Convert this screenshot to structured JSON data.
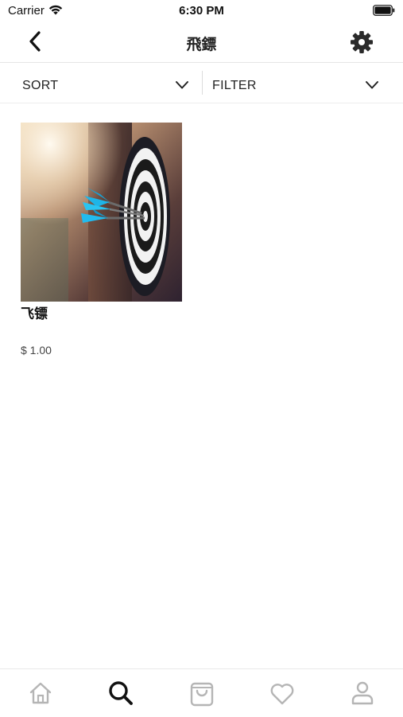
{
  "status_bar": {
    "carrier": "Carrier",
    "time": "6:30 PM"
  },
  "nav": {
    "title": "飛鏢",
    "back_icon": "chevron-left-icon",
    "settings_icon": "gear-icon"
  },
  "toolbar": {
    "sort_label": "SORT",
    "filter_label": "FILTER"
  },
  "products": [
    {
      "name": "飞镖",
      "price": "$ 1.00",
      "image": "dartboard-photo"
    }
  ],
  "tab_bar": {
    "tabs": [
      {
        "icon": "home-icon",
        "active": false
      },
      {
        "icon": "search-icon",
        "active": true
      },
      {
        "icon": "shopping-bag-icon",
        "active": false
      },
      {
        "icon": "heart-icon",
        "active": false
      },
      {
        "icon": "profile-icon",
        "active": false
      }
    ]
  },
  "colors": {
    "active_tab": "#111111",
    "inactive_tab": "#b5b5b5",
    "divider": "#e6e6e6"
  }
}
